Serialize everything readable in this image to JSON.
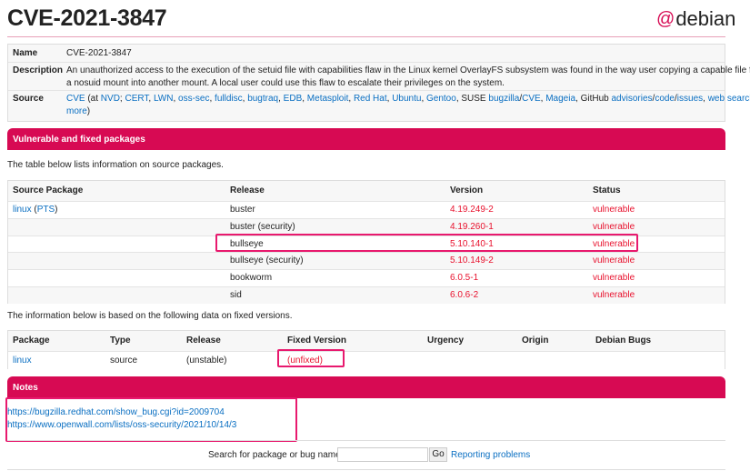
{
  "title": "CVE-2021-3847",
  "logo": "debian",
  "info": {
    "name_label": "Name",
    "name": "CVE-2021-3847",
    "desc_label": "Description",
    "desc1": "An unauthorized access to the execution of the setuid file with capabilities flaw in the Linux kernel OverlayFS subsystem was found in the way user copying a capable file from",
    "desc2": "a nosuid mount into another mount. A local user could use this flaw to escalate their privileges on the system.",
    "source_label": "Source",
    "source_links": [
      "CVE",
      " (at ",
      "NVD",
      "; ",
      "CERT",
      ", ",
      "LWN",
      ", ",
      "oss-sec",
      ", ",
      "fulldisc",
      ", ",
      "bugtraq",
      ", ",
      "EDB",
      ", ",
      "Metasploit",
      ", ",
      "Red Hat",
      ", ",
      "Ubuntu",
      ", ",
      "Gentoo",
      ", SUSE ",
      "bugzilla",
      "/",
      "CVE",
      ", ",
      "Mageia",
      ", GitHub ",
      "advisories",
      "/",
      "code",
      "/",
      "issues",
      ", ",
      "web search",
      ","
    ],
    "more": "more"
  },
  "vuln_header": "Vulnerable and fixed packages",
  "vuln_intro": "The table below lists information on source packages.",
  "vuln_table": {
    "headers": [
      "Source Package",
      "Release",
      "Version",
      "Status"
    ],
    "package": "linux",
    "pts": "PTS",
    "rows": [
      {
        "release": "buster",
        "version": "4.19.249-2",
        "status": "vulnerable"
      },
      {
        "release": "buster (security)",
        "version": "4.19.260-1",
        "status": "vulnerable"
      },
      {
        "release": "bullseye",
        "version": "5.10.140-1",
        "status": "vulnerable"
      },
      {
        "release": "bullseye (security)",
        "version": "5.10.149-2",
        "status": "vulnerable"
      },
      {
        "release": "bookworm",
        "version": "6.0.5-1",
        "status": "vulnerable"
      },
      {
        "release": "sid",
        "version": "6.0.6-2",
        "status": "vulnerable"
      }
    ]
  },
  "fixed_intro": "The information below is based on the following data on fixed versions.",
  "fixed_table": {
    "headers": [
      "Package",
      "Type",
      "Release",
      "Fixed Version",
      "Urgency",
      "Origin",
      "Debian Bugs"
    ],
    "row": {
      "package": "linux",
      "type": "source",
      "release": "(unstable)",
      "fixed": "(unfixed)"
    }
  },
  "notes_header": "Notes",
  "notes": [
    "https://bugzilla.redhat.com/show_bug.cgi?id=2009704",
    "https://www.openwall.com/lists/oss-security/2021/10/14/3"
  ],
  "footer": {
    "search_label": "Search for package or bug name:",
    "go": "Go",
    "report": "Reporting problems"
  },
  "colors": {
    "accent": "#d70a53",
    "link": "#0a6fc2",
    "vulnerable": "#e8112d",
    "highlight": "#e8196e"
  }
}
